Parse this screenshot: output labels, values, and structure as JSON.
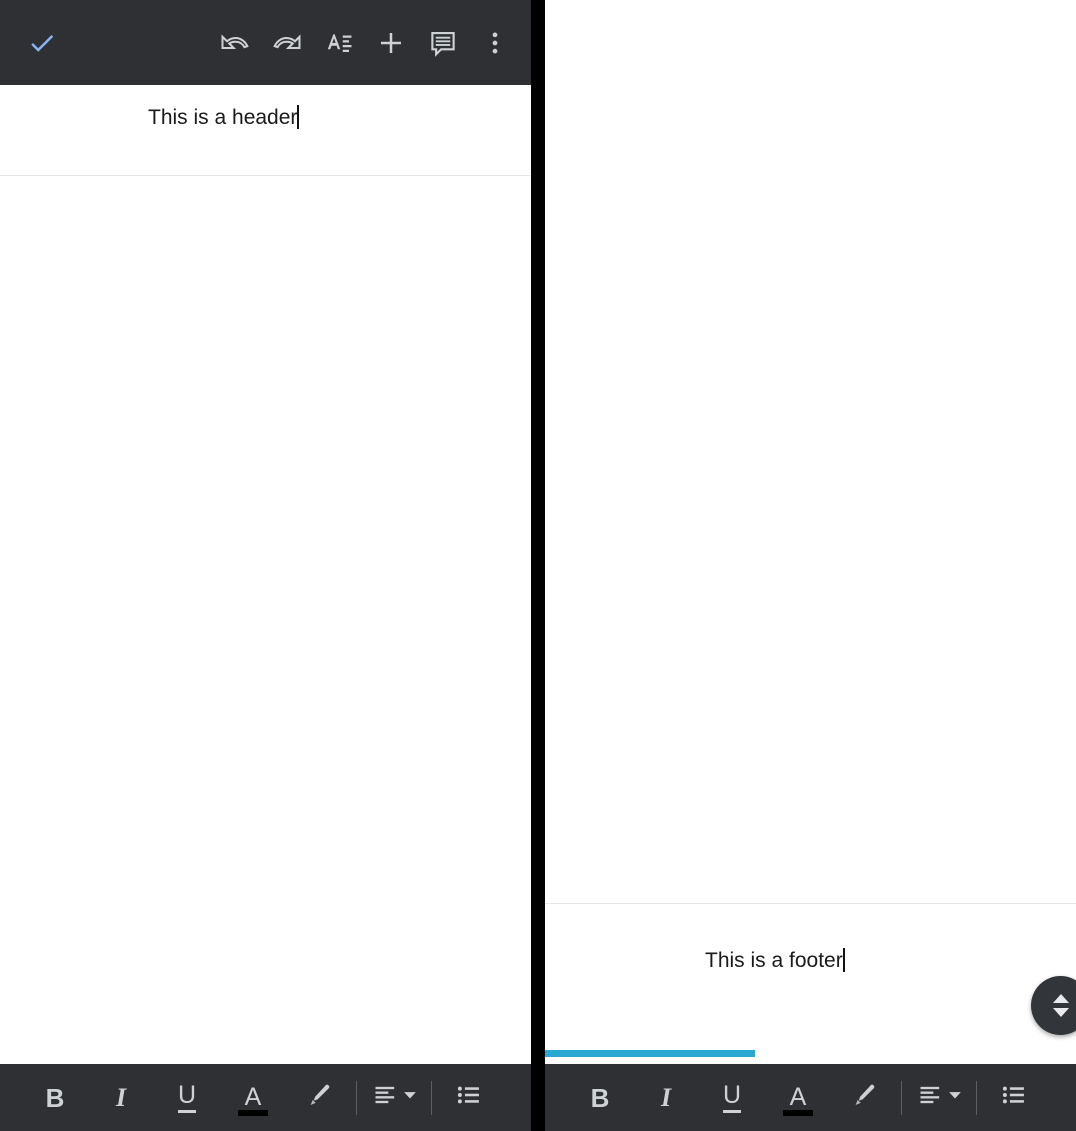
{
  "app": {
    "name": "Google Docs mobile editor",
    "view_description": "Split comparison: header editing view (left) and footer editing view (right)"
  },
  "colors": {
    "toolbar_bg": "#2e3033",
    "toolbar_icon": "#cfd2d5",
    "accept_check": "#8ab4f8",
    "page_bg": "#ffffff",
    "divider_black": "#000000",
    "hf_separator": "#e4e6e8",
    "progress_blue": "#29a8d2",
    "fab_bg": "#323539",
    "text_color": "#1a1a1a",
    "text_color_swatch": "#000000"
  },
  "top_toolbar": {
    "buttons": [
      {
        "name": "accept-button",
        "icon": "check-icon",
        "label": "Accept"
      },
      {
        "name": "undo-button",
        "icon": "undo-icon",
        "label": "Undo"
      },
      {
        "name": "redo-button",
        "icon": "redo-icon",
        "label": "Redo"
      },
      {
        "name": "format-button",
        "icon": "format-text-icon",
        "label": "Format"
      },
      {
        "name": "insert-button",
        "icon": "plus-icon",
        "label": "Insert"
      },
      {
        "name": "comment-button",
        "icon": "comment-icon",
        "label": "Comment"
      },
      {
        "name": "more-options-button",
        "icon": "overflow-menu-icon",
        "label": "More options"
      }
    ]
  },
  "bottom_toolbar": {
    "buttons": [
      {
        "name": "bold-button",
        "icon": "bold-icon",
        "label": "B"
      },
      {
        "name": "italic-button",
        "icon": "italic-icon",
        "label": "I"
      },
      {
        "name": "underline-button",
        "icon": "underline-icon",
        "label": "U"
      },
      {
        "name": "text-color-button",
        "icon": "text-color-icon",
        "label": "A"
      },
      {
        "name": "highlight-button",
        "icon": "highlight-pen-icon",
        "label": "Highlight"
      },
      {
        "name": "align-button",
        "icon": "align-left-icon",
        "label": "Align"
      },
      {
        "name": "list-button",
        "icon": "bulleted-list-icon",
        "label": "List"
      }
    ]
  },
  "left_panel": {
    "name": "header-editing-panel",
    "header": {
      "text": "This is a header",
      "caret_visible": true
    }
  },
  "right_panel": {
    "name": "footer-editing-panel",
    "footer": {
      "text": "This is a footer",
      "caret_visible": true
    },
    "scroll_handle": {
      "name": "scroll-fab",
      "up_icon": "triangle-up-icon",
      "down_icon": "triangle-down-icon"
    },
    "progress_bar": {
      "name": "loading-progress-bar",
      "color": "#29a8d2"
    }
  }
}
